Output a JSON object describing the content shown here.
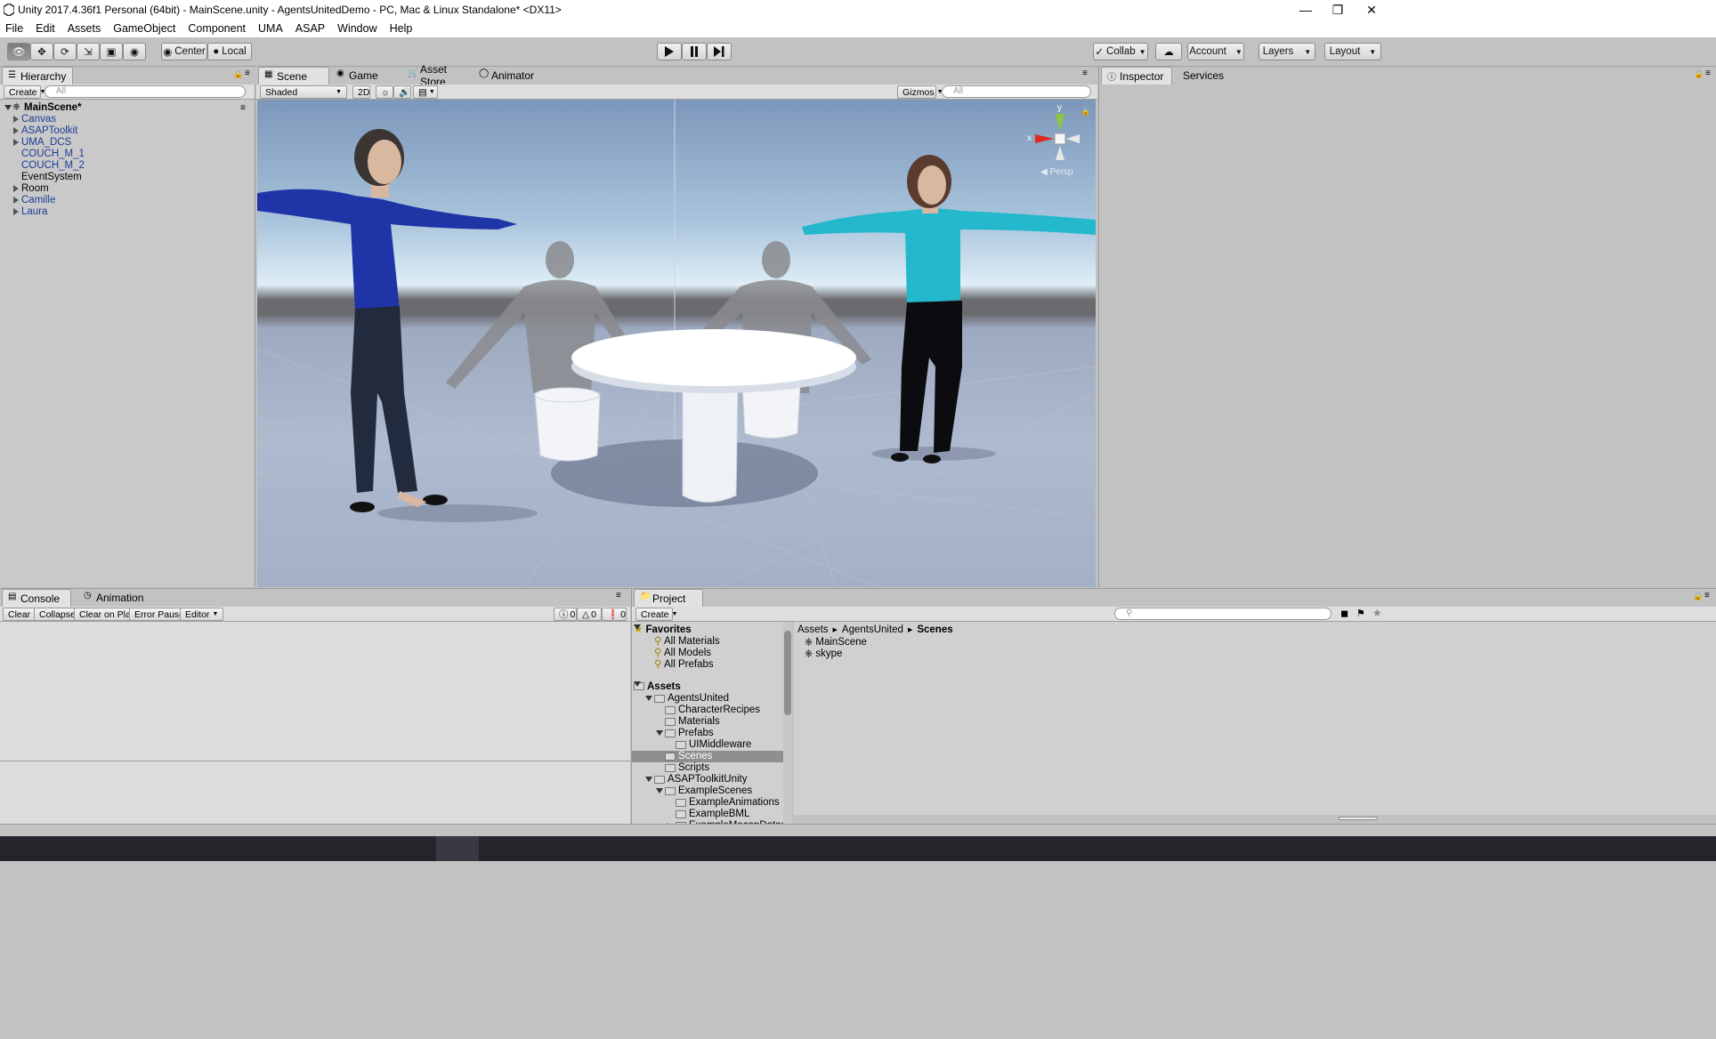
{
  "window": {
    "title": "Unity 2017.4.36f1 Personal (64bit) - MainScene.unity - AgentsUnitedDemo - PC, Mac & Linux Standalone* <DX11>"
  },
  "menu": [
    "File",
    "Edit",
    "Assets",
    "GameObject",
    "Component",
    "UMA",
    "ASAP",
    "Window",
    "Help"
  ],
  "toolbar": {
    "pivot": "Center",
    "space": "Local",
    "collab": "Collab",
    "account": "Account",
    "layers": "Layers",
    "layout": "Layout"
  },
  "hierarchy": {
    "tab": "Hierarchy",
    "create": "Create",
    "search_placeholder": "All",
    "scene": "MainScene*",
    "items": [
      {
        "label": "Canvas",
        "expandable": true,
        "color": "blue"
      },
      {
        "label": "ASAPToolkit",
        "expandable": true,
        "color": "blue"
      },
      {
        "label": "UMA_DCS",
        "expandable": true,
        "color": "blue"
      },
      {
        "label": "COUCH_M_1",
        "expandable": false,
        "color": "blue"
      },
      {
        "label": "COUCH_M_2",
        "expandable": false,
        "color": "blue"
      },
      {
        "label": "EventSystem",
        "expandable": false,
        "color": "black"
      },
      {
        "label": "Room",
        "expandable": true,
        "color": "black"
      },
      {
        "label": "Camille",
        "expandable": true,
        "color": "blue"
      },
      {
        "label": "Laura",
        "expandable": true,
        "color": "blue"
      }
    ]
  },
  "scene": {
    "tabs": [
      "Scene",
      "Game",
      "Asset Store",
      "Animator"
    ],
    "shading": "Shaded",
    "mode_2d": "2D",
    "gizmos": "Gizmos",
    "search_placeholder": "All",
    "persp_label": "Persp",
    "axis_y": "y",
    "axis_x": "x"
  },
  "inspector": {
    "tabs": [
      "Inspector",
      "Services"
    ]
  },
  "console": {
    "tabs": [
      "Console",
      "Animation"
    ],
    "buttons": [
      "Clear",
      "Collapse",
      "Clear on Play",
      "Error Pause",
      "Editor"
    ],
    "counts": {
      "info": "0",
      "warn": "0",
      "error": "0"
    }
  },
  "project": {
    "tab": "Project",
    "create": "Create",
    "breadcrumb": [
      "Assets",
      "AgentsUnited",
      "Scenes"
    ],
    "favorites_label": "Favorites",
    "favorites": [
      "All Materials",
      "All Models",
      "All Prefabs"
    ],
    "assets_label": "Assets",
    "tree": [
      {
        "label": "AgentsUnited",
        "depth": 1,
        "expanded": true
      },
      {
        "label": "CharacterRecipes",
        "depth": 2,
        "expanded": null
      },
      {
        "label": "Materials",
        "depth": 2,
        "expanded": null
      },
      {
        "label": "Prefabs",
        "depth": 2,
        "expanded": true
      },
      {
        "label": "UIMiddleware",
        "depth": 3,
        "expanded": null
      },
      {
        "label": "Scenes",
        "depth": 2,
        "expanded": null,
        "selected": true
      },
      {
        "label": "Scripts",
        "depth": 2,
        "expanded": null
      },
      {
        "label": "ASAPToolkitUnity",
        "depth": 1,
        "expanded": true
      },
      {
        "label": "ExampleScenes",
        "depth": 2,
        "expanded": true
      },
      {
        "label": "ExampleAnimations",
        "depth": 3,
        "expanded": null
      },
      {
        "label": "ExampleBML",
        "depth": 3,
        "expanded": null
      },
      {
        "label": "ExampleMocapDataset",
        "depth": 3,
        "expanded": false
      }
    ],
    "files": [
      "MainScene",
      "skype"
    ]
  }
}
